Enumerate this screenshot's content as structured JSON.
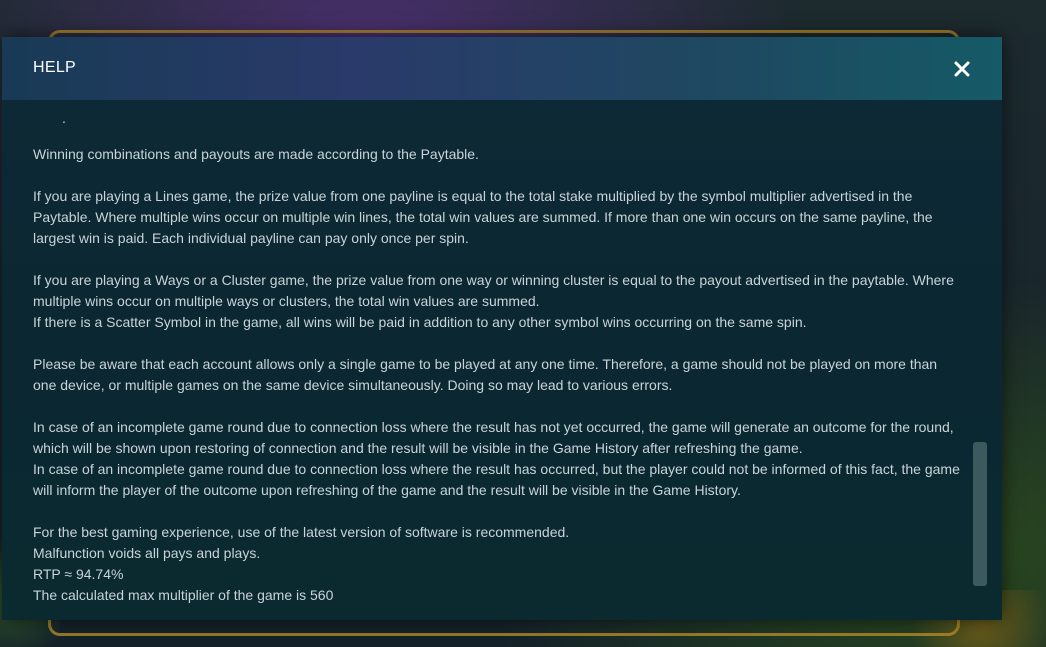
{
  "dialog": {
    "title": "HELP",
    "close_icon": "close-icon"
  },
  "content": {
    "dot": ".",
    "paragraphs": [
      "Winning combinations and payouts are made according to the Paytable.",
      "If you are playing a Lines game, the prize value from one payline is equal to the total stake multiplied by the symbol multiplier advertised in the Paytable. Where multiple wins occur on multiple win lines, the total win values are summed. If more than one win occurs on the same payline, the largest win is paid. Each individual payline can pay only once per spin.",
      "If you are playing a Ways or a Cluster game, the prize value from one way or winning cluster is equal to the payout advertised in the paytable. Where multiple wins occur on multiple ways or clusters, the total win values are summed.",
      "If there is a Scatter Symbol in the game, all wins will be paid in addition to any other symbol wins occurring on the same spin.",
      "Please be aware that each account allows only a single game to be played at any one time. Therefore, a game should not be played on more than one device, or multiple games on the same device simultaneously. Doing so may lead to various errors.",
      "In case of an incomplete game round due to connection loss where the result has not yet occurred, the game will generate an outcome for the round, which will be shown upon restoring of connection and the result will be visible in the Game History after refreshing the game.",
      "In case of an incomplete game round due to connection loss where the result has occurred, but the player could not be informed of this fact, the game will inform the player of the outcome upon refreshing of the game and the result will be visible in the Game History.",
      "For the best gaming experience, use of the latest version of software is recommended.",
      "Malfunction voids all pays and plays.",
      "RTP ≈ 94.74%",
      "The calculated max multiplier of the game is 560"
    ]
  },
  "colors": {
    "header_gradient_start": "#183a55",
    "body_bg": "#0b2732",
    "text": "#c9d3d8",
    "scrollbar_thumb": "#3c5a5e",
    "frame_gold": "#b88e2a"
  }
}
